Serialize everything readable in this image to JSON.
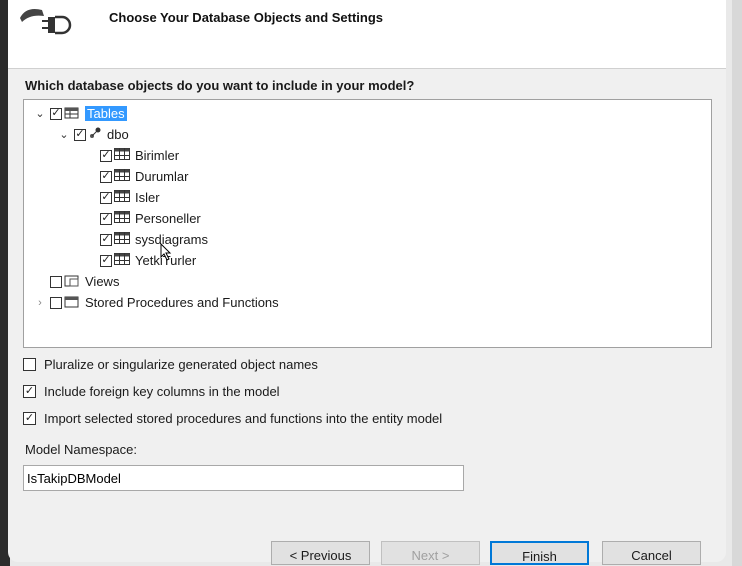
{
  "header": {
    "title": "Choose Your Database Objects and Settings",
    "icon": "database-connection-icon"
  },
  "question": "Which database objects do you want to include in your model?",
  "tree": {
    "tables": "Tables",
    "dbo": "dbo",
    "table_items": [
      "Birimler",
      "Durumlar",
      "Isler",
      "Personeller",
      "sysdiagrams",
      "YetkiTurler"
    ],
    "views": "Views",
    "procs": "Stored Procedures and Functions"
  },
  "options": {
    "pluralize": {
      "label": "Pluralize or singularize generated object names",
      "checked": false
    },
    "foreign_keys": {
      "label": "Include foreign key columns in the model",
      "checked": true
    },
    "import_procs": {
      "label": "Import selected stored procedures and functions into the entity model",
      "checked": true
    }
  },
  "namespace": {
    "label": "Model Namespace:",
    "value": "IsTakipDBModel"
  },
  "buttons": {
    "previous": "< Previous",
    "next": "Next >",
    "finish": "Finish",
    "cancel": "Cancel"
  }
}
